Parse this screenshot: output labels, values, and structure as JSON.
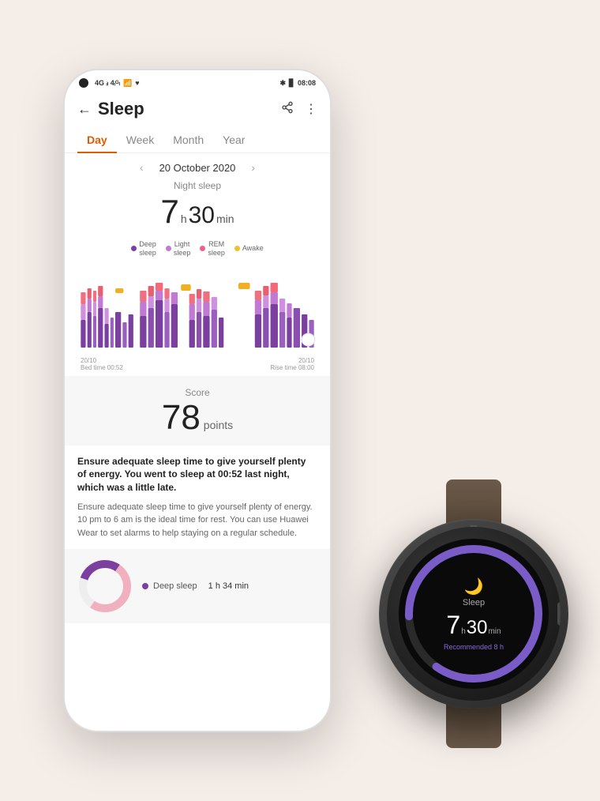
{
  "background_color": "#f5ede8",
  "phone": {
    "status_bar": {
      "time": "08:08",
      "signal": "4G",
      "wifi": true,
      "battery": true,
      "health_icon": true
    },
    "header": {
      "title": "Sleep",
      "back_label": "←",
      "share_icon": "share",
      "more_icon": "⋮"
    },
    "tabs": [
      {
        "label": "Day",
        "active": true
      },
      {
        "label": "Week",
        "active": false
      },
      {
        "label": "Month",
        "active": false
      },
      {
        "label": "Year",
        "active": false
      }
    ],
    "date_nav": {
      "date": "20 October 2020",
      "prev_icon": "‹",
      "next_icon": "›"
    },
    "sleep_summary": {
      "label": "Night sleep",
      "hours": "7",
      "hours_unit": "h",
      "minutes": "30",
      "minutes_unit": "min"
    },
    "legend": [
      {
        "color": "#7b3fa0",
        "label": "Deep\nsleep"
      },
      {
        "color": "#c07ad4",
        "label": "Light\nsleep"
      },
      {
        "color": "#f06080",
        "label": "REM\nsleep"
      },
      {
        "color": "#f0c030",
        "label": "Awake"
      }
    ],
    "chart": {
      "start_label": "20/10\nBed time 00:52",
      "end_label": "20/10\nRise time 08:00"
    },
    "score": {
      "label": "Score",
      "value": "78",
      "unit": "points"
    },
    "advice_bold": "Ensure adequate sleep time to give yourself plenty of energy. You went to sleep at 00:52 last night, which was a little late.",
    "advice_regular": "Ensure adequate sleep time to give yourself plenty of energy. 10 pm to 6 am is the ideal time for rest. You can use Huawei Wear to set alarms to help staying on a regular schedule.",
    "breakdown": {
      "deep_sleep_label": "Deep sleep",
      "deep_sleep_value": "1 h 34 min",
      "deep_sleep_color": "#7b3fa0"
    }
  },
  "watch": {
    "sleep_label": "Sleep",
    "hours": "7",
    "hours_unit": "h",
    "minutes": "30",
    "minutes_unit": "min",
    "recommended_label": "Recommended",
    "recommended_value": "8 h",
    "arc_color": "#7a5cc8",
    "moon_icon": "🌙"
  }
}
